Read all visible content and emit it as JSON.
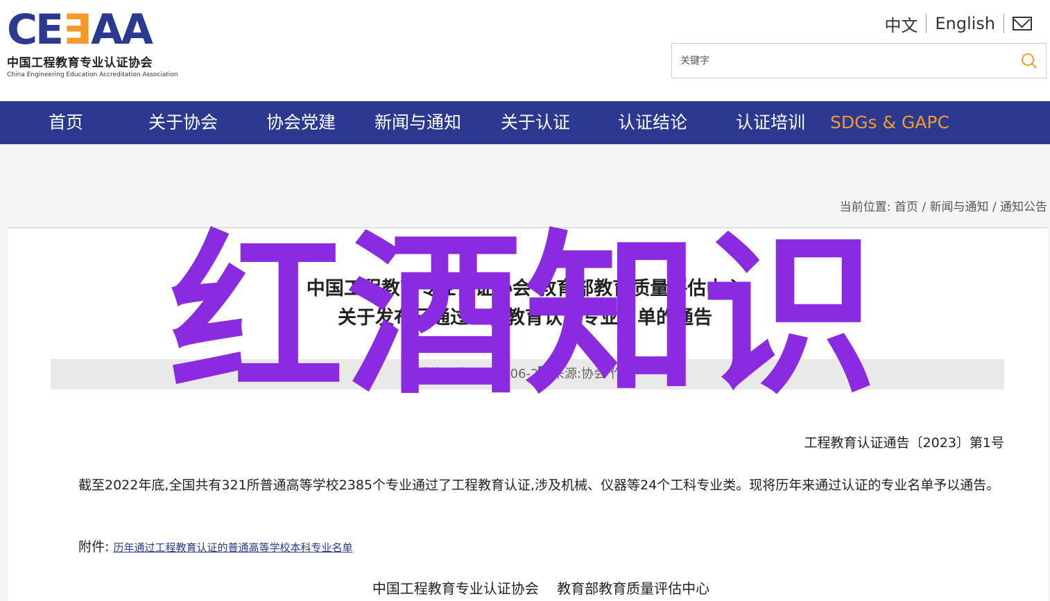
{
  "logo": {
    "mark_a": "CE",
    "mark_b": "∃",
    "mark_c": "AA",
    "cn": "中国工程教育专业认证协会",
    "en": "China Engineering Education Accreditation Association"
  },
  "lang": {
    "zh": "中文",
    "en": "English",
    "mail_icon": "mail-icon"
  },
  "search": {
    "placeholder": "关键字",
    "icon": "search-icon",
    "icon_color": "#f39a2b"
  },
  "nav": {
    "items": [
      "首页",
      "关于协会",
      "协会党建",
      "新闻与通知",
      "关于认证",
      "认证结论",
      "认证培训",
      "SDGs & GAPC"
    ],
    "bg_color": "#2b3991",
    "accent_color": "#f39a2b"
  },
  "breadcrumb": {
    "prefix": "当前位置:",
    "items": [
      "首页",
      "新闻与通知",
      "通知公告"
    ],
    "sep": "/"
  },
  "article": {
    "title_line1": "中国工程教育专业认证协会 教育部教育质量评估中心",
    "title_line2": "关于发布已通过工程教育认证专业名单的通告",
    "meta": "发布日期:2023-06-2█ 来源:协会 作者",
    "doc_no": "工程教育认证通告〔2023〕第1号",
    "paragraph": "截至2022年底,全国共有321所普通高等学校2385个专业通过了工程教育认证,涉及机械、仪器等24个工科专业类。现将历年来通过认证的专业名单予以通告。",
    "attachment_label": "附件:",
    "attachment_link": "历年通过工程教育认证的普通高等学校本科专业名单",
    "signers": [
      "中国工程教育专业认证协会",
      "教育部教育质量评估中心"
    ]
  },
  "watermark": {
    "text": "红酒知识",
    "color": "#8a2be2"
  }
}
